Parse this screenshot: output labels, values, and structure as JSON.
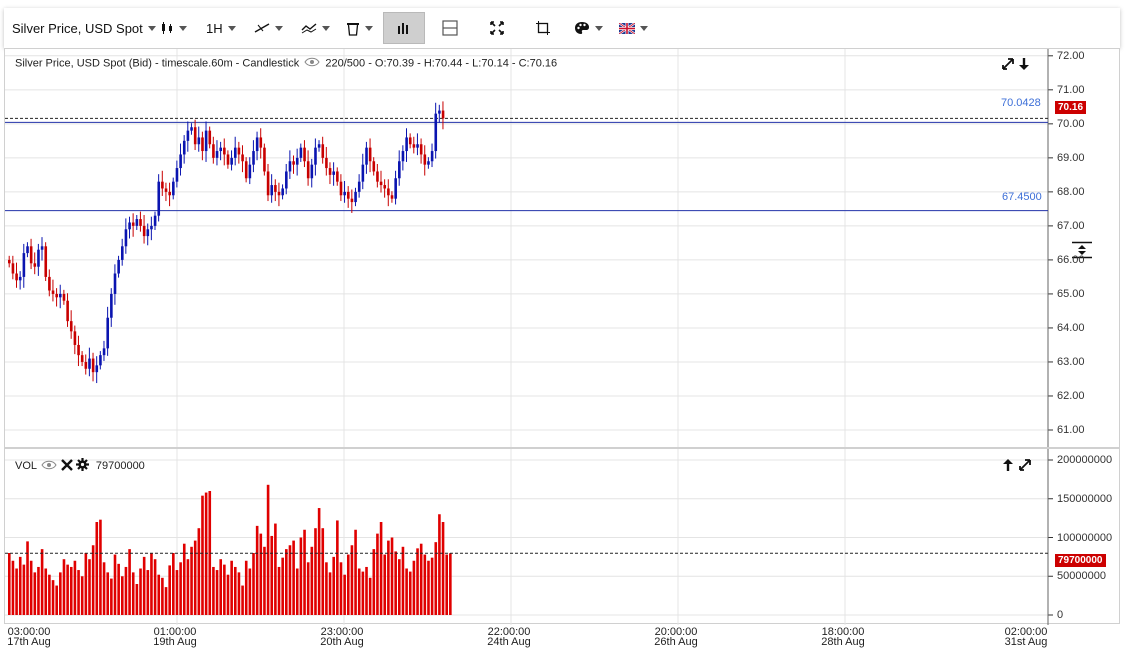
{
  "toolbar": {
    "instrument_label": "Silver Price, USD Spot",
    "timeframe_label": "1H",
    "icons": [
      "candlestick-icon",
      "trendline-icon",
      "indicator-icon",
      "delete-icon",
      "bar-chart-icon",
      "layout-icon",
      "fullscreen-icon",
      "crop-icon",
      "palette-icon",
      "flag-icon"
    ]
  },
  "price_panel": {
    "title": "Silver Price, USD Spot (Bid) - timescale.60m - Candlestick",
    "counter": "220/500",
    "ohlc": "- O:70.39 - H:70.44 - L:70.14 - C:70.16",
    "y_ticks": [
      "72.00",
      "71.00",
      "70.00",
      "69.00",
      "68.00",
      "67.00",
      "66.00",
      "65.00",
      "64.00",
      "63.00",
      "62.00",
      "61.00"
    ],
    "y_min": 60.5,
    "y_max": 72.2,
    "current_price": "70.16",
    "hline_upper": {
      "label": "70.0428",
      "value": 70.0428
    },
    "hline_lower": {
      "label": "67.4500",
      "value": 67.45
    },
    "up_color": "#0a14b0",
    "down_color": "#c80000"
  },
  "volume_panel": {
    "title": "VOL",
    "value": "79700000",
    "y_ticks": [
      "200000000",
      "150000000",
      "100000000",
      "50000000",
      "0"
    ],
    "y_max": 200000000,
    "current_volume": "79700000",
    "bar_color": "#e00000"
  },
  "x_axis": [
    {
      "time": "03:00:00",
      "date": "17th Aug"
    },
    {
      "time": "01:00:00",
      "date": "19th Aug"
    },
    {
      "time": "23:00:00",
      "date": "20th Aug"
    },
    {
      "time": "22:00:00",
      "date": "24th Aug"
    },
    {
      "time": "20:00:00",
      "date": "26th Aug"
    },
    {
      "time": "18:00:00",
      "date": "28th Aug"
    },
    {
      "time": "02:00:00",
      "date": "31st Aug"
    }
  ],
  "chart_data": {
    "type": "candlestick",
    "close_series": [
      65.9,
      65.6,
      65.4,
      65.5,
      66.2,
      66.4,
      65.9,
      65.8,
      66.3,
      66.4,
      65.5,
      65.1,
      65.0,
      64.9,
      65.0,
      64.8,
      64.2,
      63.9,
      63.5,
      63.2,
      63.0,
      62.8,
      63.1,
      62.7,
      62.9,
      63.2,
      63.4,
      64.3,
      65.0,
      65.6,
      66.0,
      66.4,
      66.9,
      67.1,
      67.0,
      67.2,
      67.0,
      66.7,
      66.9,
      67.0,
      67.3,
      68.3,
      68.1,
      68.0,
      67.9,
      68.3,
      68.7,
      69.1,
      69.5,
      69.8,
      69.9,
      69.4,
      69.6,
      69.2,
      69.8,
      69.4,
      69.0,
      69.2,
      69.3,
      69.1,
      68.8,
      69.0,
      69.3,
      69.1,
      68.9,
      68.4,
      68.8,
      69.2,
      69.6,
      69.3,
      68.6,
      67.9,
      68.2,
      68.0,
      67.9,
      68.1,
      68.6,
      68.9,
      68.8,
      69.0,
      69.3,
      68.9,
      68.4,
      68.8,
      69.3,
      69.4,
      69.0,
      68.7,
      68.5,
      68.6,
      68.3,
      67.9,
      68.0,
      67.8,
      67.7,
      68.0,
      68.3,
      68.8,
      69.3,
      68.9,
      68.6,
      68.3,
      68.2,
      68.1,
      67.9,
      67.8,
      68.4,
      68.9,
      69.2,
      69.6,
      69.4,
      69.3,
      69.4,
      69.1,
      68.8,
      68.9,
      69.2,
      70.3,
      70.39,
      70.16
    ],
    "volume_series": [
      80,
      70,
      60,
      75,
      65,
      95,
      70,
      55,
      62,
      85,
      60,
      52,
      45,
      38,
      55,
      72,
      65,
      62,
      70,
      58,
      50,
      80,
      72,
      90,
      120,
      123,
      68,
      55,
      47,
      78,
      66,
      50,
      62,
      85,
      55,
      40,
      60,
      75,
      58,
      80,
      72,
      52,
      48,
      36,
      64,
      80,
      58,
      68,
      92,
      72,
      88,
      96,
      112,
      154,
      158,
      160,
      62,
      58,
      72,
      65,
      52,
      70,
      62,
      55,
      38,
      70,
      60,
      80,
      115,
      105,
      88,
      168,
      102,
      118,
      62,
      74,
      85,
      90,
      96,
      60,
      100,
      110,
      68,
      88,
      112,
      138,
      112,
      68,
      55,
      75,
      122,
      68,
      52,
      78,
      90,
      110,
      60,
      56,
      62,
      48,
      85,
      105,
      120,
      78,
      96,
      100,
      82,
      72,
      88,
      60,
      56,
      70,
      86,
      92,
      78,
      70,
      74,
      94,
      130,
      120,
      78,
      79.7
    ]
  }
}
